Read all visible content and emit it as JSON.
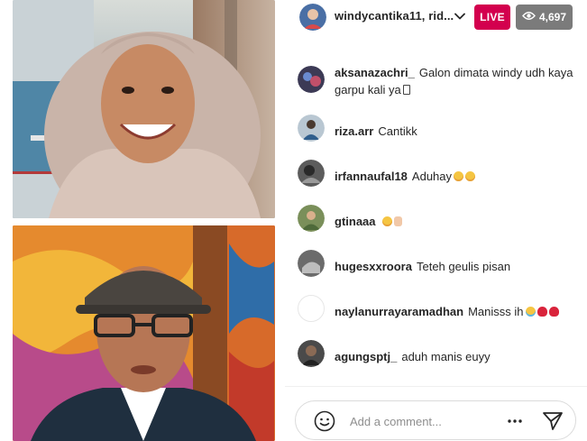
{
  "header": {
    "host_name": "windycantika11, rid...",
    "live_label": "LIVE",
    "viewer_count": "4,697"
  },
  "comments": [
    {
      "user": "aksanazachri_",
      "text": "Galon dimata windy udh kaya garpu kali ya"
    },
    {
      "user": "riza.arr",
      "text": "Cantikk"
    },
    {
      "user": "irfannaufal18",
      "text": "Aduhay"
    },
    {
      "user": "gtinaaa",
      "text": ""
    },
    {
      "user": "hugesxxroora",
      "text": "Teteh geulis pisan"
    },
    {
      "user": "naylanurrayaramadhan",
      "text": "Manisss ih"
    },
    {
      "user": "agungsptj_",
      "text": "aduh manis euyy"
    }
  ],
  "composer": {
    "placeholder": "Add a comment..."
  },
  "icons": {
    "chevron": "chevron-down-icon",
    "eye": "eye-icon",
    "emoji": "smiley-icon",
    "more": "more-horizontal-icon",
    "send": "send-icon"
  },
  "colors": {
    "live_badge": "#d3004e",
    "viewer_badge": "#7b7b7b",
    "text": "#262626",
    "placeholder": "#8e8e8e"
  }
}
